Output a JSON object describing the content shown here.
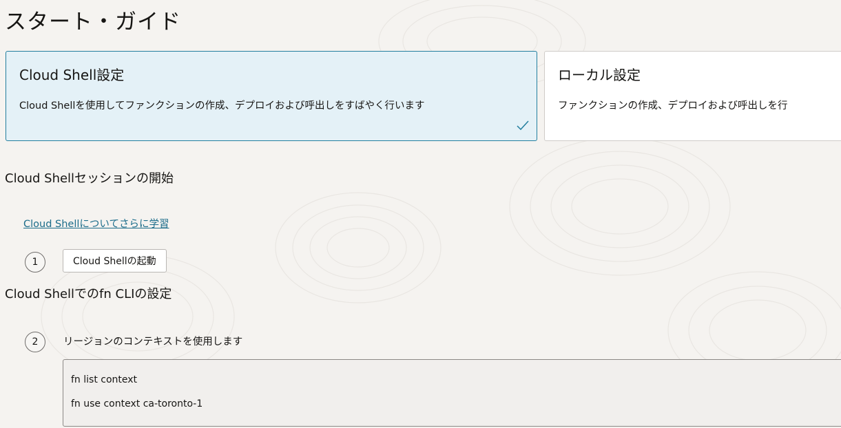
{
  "page": {
    "title": "スタート・ガイド"
  },
  "cards": {
    "cloud_shell": {
      "title": "Cloud Shell設定",
      "description": "Cloud Shellを使用してファンクションの作成、デプロイおよび呼出しをすばやく行います",
      "selected": true
    },
    "local": {
      "title": "ローカル設定",
      "description": "ファンクションの作成、デプロイおよび呼出しを行"
    }
  },
  "sections": {
    "session_heading": "Cloud Shellセッションの開始",
    "learn_link": "Cloud Shellについてさらに学習",
    "cli_heading": "Cloud Shellでのfn CLIの設定"
  },
  "steps": [
    {
      "number": "1",
      "button_label": "Cloud Shellの起動"
    },
    {
      "number": "2",
      "label": "リージョンのコンテキストを使用します",
      "code": [
        "fn list context",
        "fn use context ca-toronto-1"
      ]
    }
  ],
  "colors": {
    "accent": "#227e9e",
    "selected_card_bg": "#e4f1f7",
    "link": "#1b6c8a",
    "background": "#f5f3f0"
  }
}
